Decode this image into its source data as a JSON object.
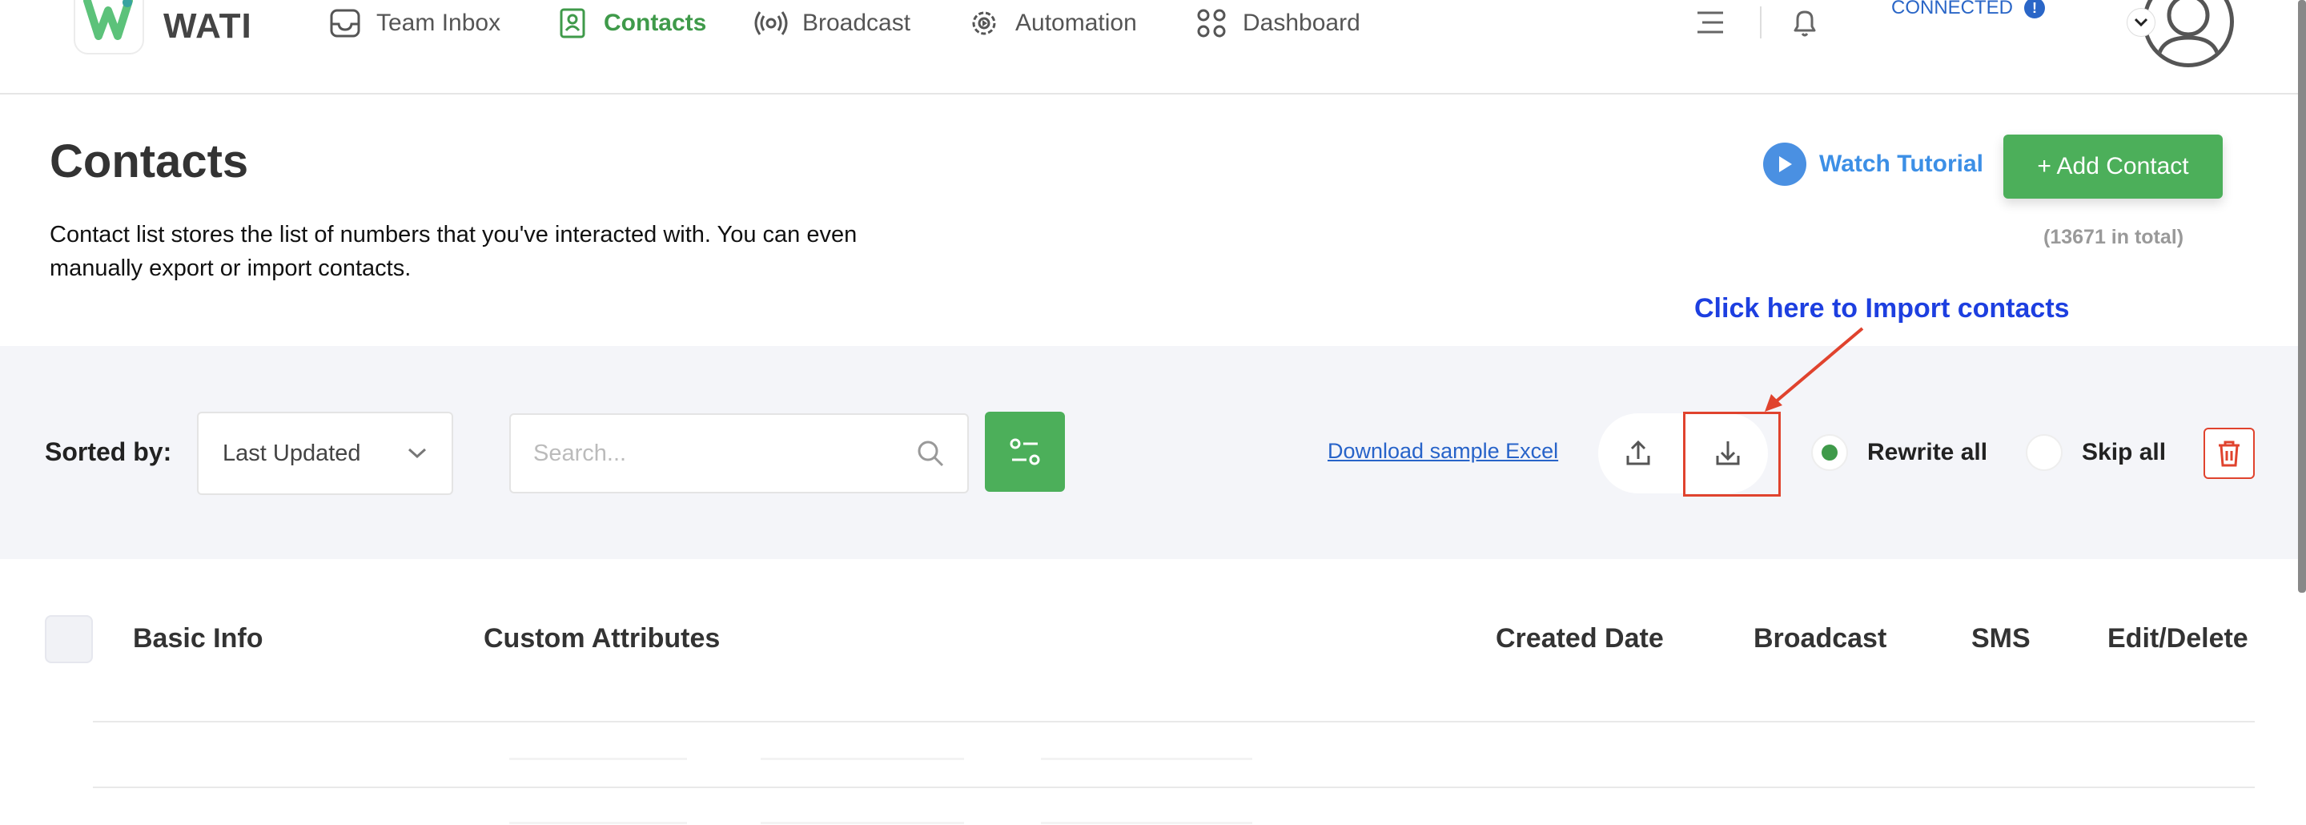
{
  "app": {
    "name": "WATI"
  },
  "nav": {
    "items": [
      {
        "label": "Team Inbox",
        "icon": "inbox-icon"
      },
      {
        "label": "Contacts",
        "icon": "contacts-book-icon",
        "active": true
      },
      {
        "label": "Broadcast",
        "icon": "broadcast-icon"
      },
      {
        "label": "Automation",
        "icon": "gear-icon"
      },
      {
        "label": "Dashboard",
        "icon": "grid-icon"
      }
    ],
    "status": "CONNECTED",
    "info_glyph": "!"
  },
  "header": {
    "title": "Contacts",
    "description": "Contact list stores the list of numbers that you've interacted with. You can even manually export or import contacts.",
    "watch_tutorial": "Watch Tutorial",
    "add_contact": "+ Add Contact",
    "total": "(13671 in total)"
  },
  "annotation": {
    "text": "Click here to Import contacts",
    "color": "#1d3fe0"
  },
  "toolbar": {
    "sorted_label": "Sorted by:",
    "sort_value": "Last Updated",
    "search_placeholder": "Search...",
    "download_sample": "Download sample Excel",
    "rewrite_all": "Rewrite all",
    "skip_all": "Skip all",
    "selected_option": "Rewrite all"
  },
  "table": {
    "columns": [
      "Basic Info",
      "Custom Attributes",
      "Created Date",
      "Broadcast",
      "SMS",
      "Edit/Delete"
    ]
  },
  "colors": {
    "brand_green": "#4caf5a",
    "link_blue": "#2763c9",
    "highlight_red": "#e0432e",
    "toolbar_bg": "#f4f5f9"
  }
}
